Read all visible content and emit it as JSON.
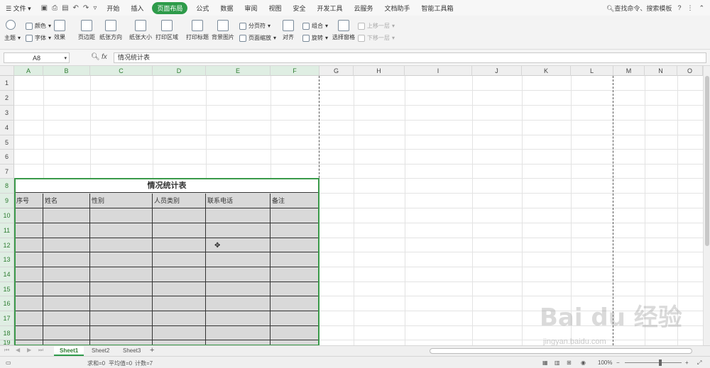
{
  "menubar": {
    "file": "文件",
    "tabs": [
      "开始",
      "插入",
      "页面布局",
      "公式",
      "数据",
      "审阅",
      "视图",
      "安全",
      "开发工具",
      "云服务",
      "文档助手",
      "智能工具箱"
    ],
    "active_tab": "页面布局",
    "search": "查找命令、搜索模板"
  },
  "ribbon": {
    "theme": "主题",
    "colors": "颜色",
    "fonts": "字体",
    "effects": "效果",
    "margins": "页边距",
    "orientation": "纸张方向",
    "size": "纸张大小",
    "print_area": "打印区域",
    "print_titles": "打印标题",
    "background": "背景图片",
    "page_break": "分页符",
    "page_zoom": "页面缩放",
    "align": "对齐",
    "group": "组合",
    "rotate": "旋转",
    "select_pane": "选择窗格",
    "bring_forward": "上移一层",
    "send_backward": "下移一层"
  },
  "formula": {
    "namebox": "A8",
    "fx": "fx",
    "content": "情况统计表"
  },
  "columns": [
    "A",
    "B",
    "C",
    "D",
    "E",
    "F",
    "G",
    "H",
    "I",
    "J",
    "K",
    "L",
    "M",
    "N",
    "O"
  ],
  "rows": [
    "1",
    "2",
    "3",
    "4",
    "5",
    "6",
    "7",
    "8",
    "9",
    "10",
    "11",
    "12",
    "13",
    "14",
    "15",
    "16",
    "17",
    "18",
    "19"
  ],
  "table": {
    "title": "情况统计表",
    "headers": [
      "序号",
      "姓名",
      "性别",
      "人员类别",
      "联系电话",
      "备注"
    ]
  },
  "sheets": [
    "Sheet1",
    "Sheet2",
    "Sheet3"
  ],
  "active_sheet": "Sheet1",
  "status": {
    "sum": "求和=0",
    "avg": "平均值=0",
    "count": "计数=7",
    "zoom": "100%"
  },
  "watermark": {
    "logo": "Bai du 经验",
    "url": "jingyan.baidu.com"
  }
}
